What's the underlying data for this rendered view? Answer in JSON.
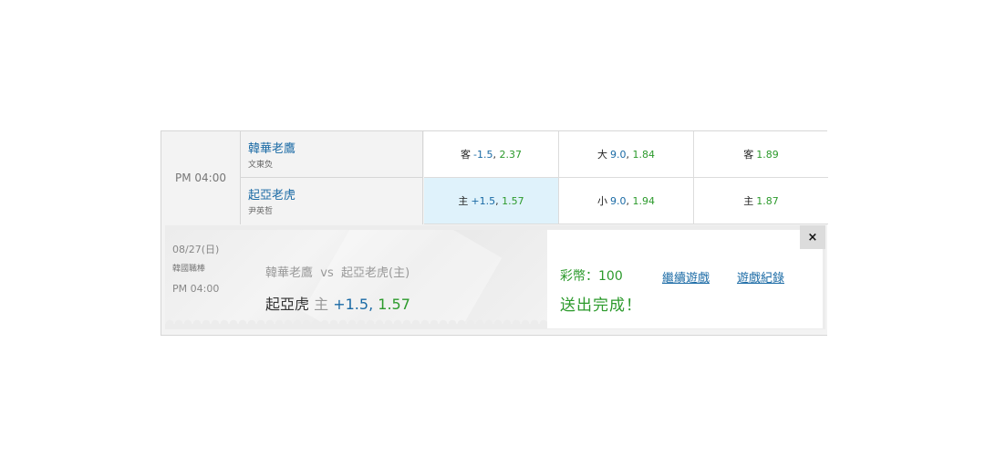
{
  "game": {
    "time": "PM 04:00",
    "away": {
      "team": "韓華老鷹",
      "pitcher": "文東烉"
    },
    "home": {
      "team": "起亞老虎",
      "pitcher": "尹英哲"
    }
  },
  "odds": {
    "row1": [
      {
        "label": "客",
        "line": "-1.5",
        "price": "2.37",
        "selected": false
      },
      {
        "label": "大",
        "line": "9.0",
        "price": "1.84",
        "selected": false
      },
      {
        "label": "客",
        "line": "",
        "price": "1.89",
        "selected": false
      }
    ],
    "row2": [
      {
        "label": "主",
        "line": "+1.5",
        "price": "1.57",
        "selected": true
      },
      {
        "label": "小",
        "line": "9.0",
        "price": "1.94",
        "selected": false
      },
      {
        "label": "主",
        "line": "",
        "price": "1.87",
        "selected": false
      }
    ]
  },
  "ticket": {
    "date": "08/27(日)",
    "league": "韓國職棒",
    "time": "PM 04:00",
    "match": "韓華老鷹  vs  起亞老虎(主)",
    "pick_team": "起亞虎",
    "pick_side": "主",
    "pick_line": "+1.5",
    "pick_price": "1.57"
  },
  "result": {
    "coins": "彩幣：100",
    "status": "送出完成！",
    "continue_link": "繼續遊戲",
    "history_link": "遊戲紀錄",
    "close": "×"
  },
  "colors": {
    "accent_blue": "#1a6aa5",
    "accent_green": "#2c9a2c",
    "selected_bg": "#dff2fb"
  }
}
